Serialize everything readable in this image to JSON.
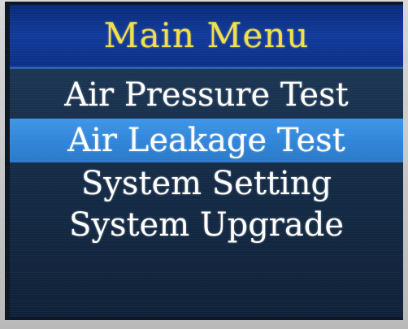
{
  "screen": {
    "title": "Main Menu",
    "selected_index": 1,
    "menu_items": [
      {
        "label": "Air Pressure Test"
      },
      {
        "label": "Air Leakage Test"
      },
      {
        "label": "System Setting"
      },
      {
        "label": "System Upgrade"
      }
    ]
  },
  "colors": {
    "title_text": "#f1e04a",
    "title_bar": "#103a9c",
    "menu_background": "#1b3553",
    "selected_highlight": "#3f95e6",
    "menu_text": "#ffffff"
  }
}
